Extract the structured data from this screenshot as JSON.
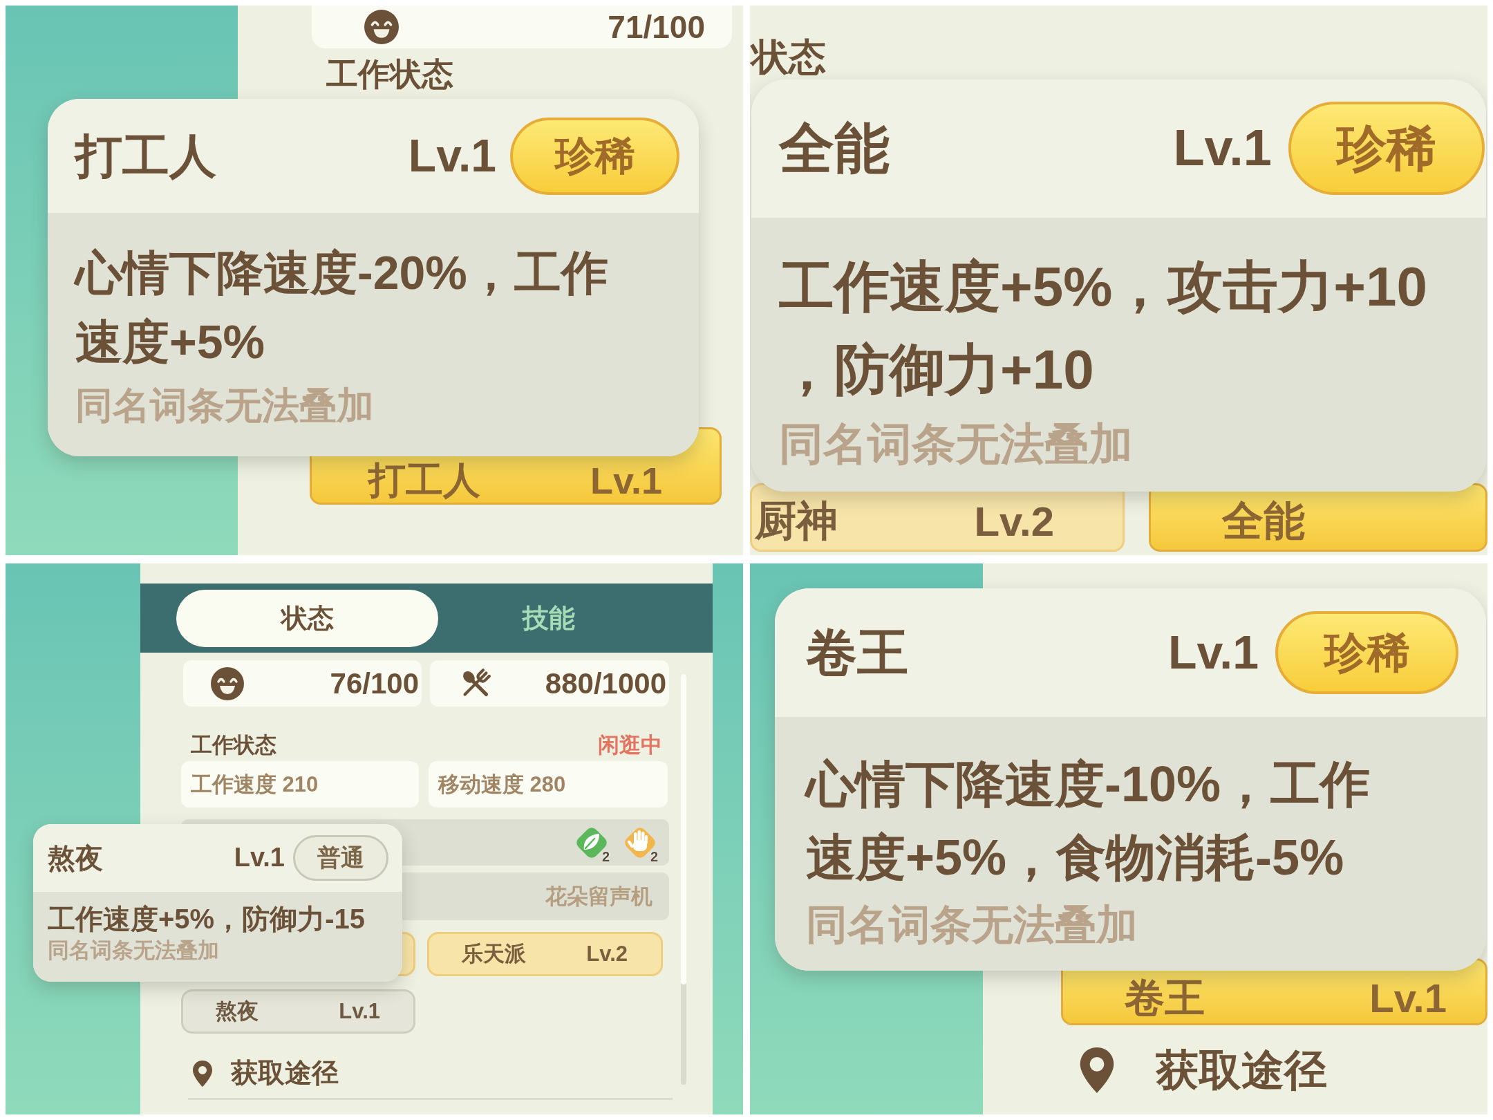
{
  "panels": [
    {
      "kind": "closeup",
      "above": [
        {
          "kind": "stat",
          "value": "71/100"
        },
        {
          "kind": "heading",
          "text": "工作状态"
        }
      ],
      "tooltip": {
        "name": "打工人",
        "level": "Lv.1",
        "badge": {
          "label": "珍稀",
          "kind": "rare"
        },
        "effect": "心情下降速度-20%，工作速度+5%",
        "note": "同名词条无法叠加"
      },
      "below": [
        {
          "kind": "chips",
          "items": [
            {
              "name": "打工人",
              "level": "Lv.1",
              "kind": "rare"
            }
          ]
        }
      ]
    },
    {
      "kind": "closeup",
      "above": [
        {
          "kind": "heading",
          "text": "状态"
        }
      ],
      "tooltip": {
        "name": "全能",
        "level": "Lv.1",
        "badge": {
          "label": "珍稀",
          "kind": "rare"
        },
        "effect": "工作速度+5%，攻击力+10，防御力+10",
        "note": "同名词条无法叠加"
      },
      "below": [
        {
          "kind": "chips",
          "items": [
            {
              "name": "厨神",
              "level": "Lv.2",
              "kind": "uncommon"
            },
            {
              "name": "全能",
              "kind": "rare"
            }
          ]
        }
      ]
    },
    {
      "kind": "sheet",
      "tabs": [
        {
          "label": "状态",
          "selected": true
        },
        {
          "label": "技能",
          "selected": false
        }
      ],
      "stats": [
        {
          "value": "76/100"
        },
        {
          "value": "880/1000"
        }
      ],
      "work": {
        "label": "工作状态",
        "status": "闲逛中",
        "fields": [
          "工作速度 210",
          "移动速度 280"
        ]
      },
      "rows": [
        {
          "kind": "icons",
          "items": [
            {
              "count": "2",
              "color": "#5bb85a"
            },
            {
              "count": "2",
              "color": "#f2b64c"
            }
          ]
        },
        {
          "kind": "text",
          "text": "花朵留声机"
        }
      ],
      "chips": [
        {
          "kind": "uncommon"
        },
        {
          "name": "乐天派",
          "level": "Lv.2",
          "kind": "uncommon"
        },
        {
          "name": "熬夜",
          "level": "Lv.1",
          "kind": "common"
        }
      ],
      "source": "获取途径",
      "tooltip": {
        "name": "熬夜",
        "level": "Lv.1",
        "badge": {
          "label": "普通",
          "kind": "common"
        },
        "effect": "工作速度+5%，防御力-15",
        "note": "同名词条无法叠加"
      }
    },
    {
      "kind": "closeup",
      "tooltip": {
        "name": "卷王",
        "level": "Lv.1",
        "badge": {
          "label": "珍稀",
          "kind": "rare"
        },
        "effect": "心情下降速度-10%，工作速度+5%，食物消耗-5%",
        "note": "同名词条无法叠加"
      },
      "below": [
        {
          "kind": "chips",
          "items": [
            {
              "name": "卷王",
              "level": "Lv.1",
              "kind": "rare"
            }
          ]
        },
        {
          "kind": "source",
          "text": "获取途径"
        }
      ]
    }
  ]
}
